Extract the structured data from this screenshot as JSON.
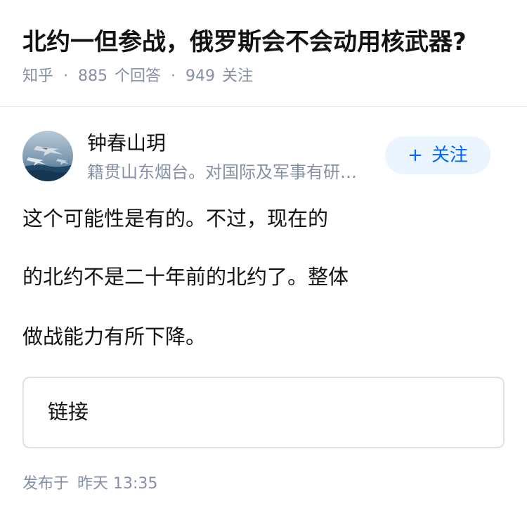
{
  "question": {
    "title": "北约一但参战，俄罗斯会不会动用核武器?",
    "source": "知乎",
    "answer_count": "885",
    "answer_label": "个回答",
    "follower_count": "949",
    "follower_label": "关注"
  },
  "author": {
    "name": "钟春山玥",
    "bio": "籍贯山东烟台。对国际及军事有研…",
    "avatar_icon": "fighter-jet-avatar"
  },
  "follow_button": {
    "icon": "+",
    "label": "关注"
  },
  "answer": {
    "paragraphs": [
      "这个可能性是有的。不过，现在的",
      "的北约不是二十年前的北约了。整体",
      "做战能力有所下降。"
    ]
  },
  "link_card": {
    "label": "链接"
  },
  "footer": {
    "publish_prefix": "发布于",
    "publish_time": "昨天 13:35"
  },
  "colors": {
    "text": "#121212",
    "muted": "#8590a6",
    "accent": "#0066ff",
    "accent_bg": "#ebf5ff"
  }
}
